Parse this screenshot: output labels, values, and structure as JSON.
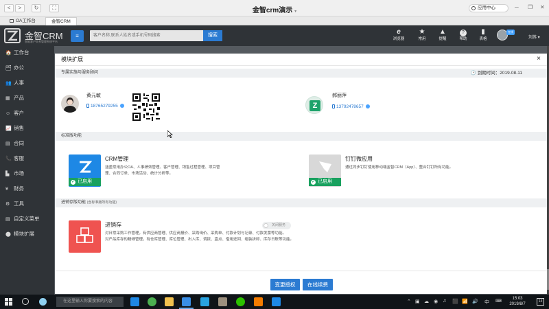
{
  "window": {
    "title": "金智crm演示",
    "title_arrow": "▾",
    "app_center": "应用中心",
    "back": "<",
    "forward": ">",
    "refresh": "↻",
    "fullscreen": "⛶"
  },
  "tabs": [
    {
      "label": "OA工作台"
    },
    {
      "label": "金智CRM"
    }
  ],
  "app": {
    "logo_text": "金智CRM",
    "logo_sub": "智能客户关系管理系统平台",
    "search_placeholder": "客户名称,联系人姓名或手机号码搜索",
    "search_button": "搜索",
    "header_icons": [
      {
        "name": "browser",
        "glyph": "e",
        "label": "浏览器"
      },
      {
        "name": "star",
        "glyph": "★",
        "label": "常用"
      },
      {
        "name": "bell",
        "glyph": "🔔",
        "label": "提醒"
      },
      {
        "name": "help",
        "glyph": "?",
        "label": "帮助"
      },
      {
        "name": "signal",
        "glyph": "▮",
        "label": "表格"
      }
    ],
    "online_badge": "在线",
    "user": "刘苏 ▾"
  },
  "sidebar": {
    "items": [
      {
        "icon": "🏠",
        "label": "工作台"
      },
      {
        "icon": "🗂",
        "label": "办公"
      },
      {
        "icon": "👥",
        "label": "人事"
      },
      {
        "icon": "▦",
        "label": "产品"
      },
      {
        "icon": "☺",
        "label": "客户"
      },
      {
        "icon": "📈",
        "label": "销售"
      },
      {
        "icon": "▤",
        "label": "合同"
      },
      {
        "icon": "📞",
        "label": "客服"
      },
      {
        "icon": "▙",
        "label": "市场"
      },
      {
        "icon": "¥",
        "label": "财务"
      },
      {
        "icon": "⚙",
        "label": "工具"
      },
      {
        "icon": "▤",
        "label": "自定义菜单"
      },
      {
        "icon": "⬤",
        "label": "模块扩展"
      }
    ]
  },
  "modal": {
    "title": "模块扩展",
    "close": "×",
    "section1": {
      "title": "专属实施与服务顾问",
      "deadline": "🕒 到期时间：2019-08-11",
      "people": [
        {
          "name": "黄元敏",
          "phone": "18765279255"
        },
        {
          "name": "郝丽萍",
          "phone": "13792478657"
        }
      ]
    },
    "section2": {
      "title": "标准版功能",
      "modules": [
        {
          "title": "CRM管理",
          "desc": "涵盖常用办公OA、人事绩效管理、客户管理、销售过程管理、项目管理、合同订单、市场活动、统计分析等。",
          "status": "已启用",
          "icon_color": "#1e88e5"
        },
        {
          "title": "钉钉微应用",
          "desc": "通过同步钉钉使用移动端金智CRM（App）、整合钉钉所有功能。",
          "status": "已启用",
          "icon_color": "#d8d8d8"
        }
      ]
    },
    "section3": {
      "title": "进销存版功能",
      "title_small": "(含标准版所有功能)",
      "modules": [
        {
          "title": "进销存",
          "desc_lines": [
            "对日常采购工作管理，有供应商管理、供应商报价、采购询价、采购单、付款计划与记录、付款发票等功能。",
            "对产品库存的精细管理，有仓库管理、库位管理、出入库、调拨、盘点、借用还回、组装拆卸、库存日账等功能。"
          ],
          "toggle": "关闭服务",
          "icon_color": "#ef5350"
        }
      ]
    },
    "footer": {
      "change_auth": "变更授权",
      "renew": "在线续费"
    }
  },
  "taskbar": {
    "search_placeholder": "在这里输入你要搜索的内容",
    "time": "15:03",
    "date": "2019/8/7",
    "ime": "中",
    "notify": "14",
    "tray": [
      "⌃",
      "▣",
      "☁",
      "◉",
      "♫",
      "⬛",
      "📶",
      "🔊"
    ]
  },
  "colors": {
    "primary": "#2b7bd2",
    "enabled": "#19a15f",
    "sidebar_bg": "#2f3337",
    "section_bg": "#eef0f2"
  }
}
